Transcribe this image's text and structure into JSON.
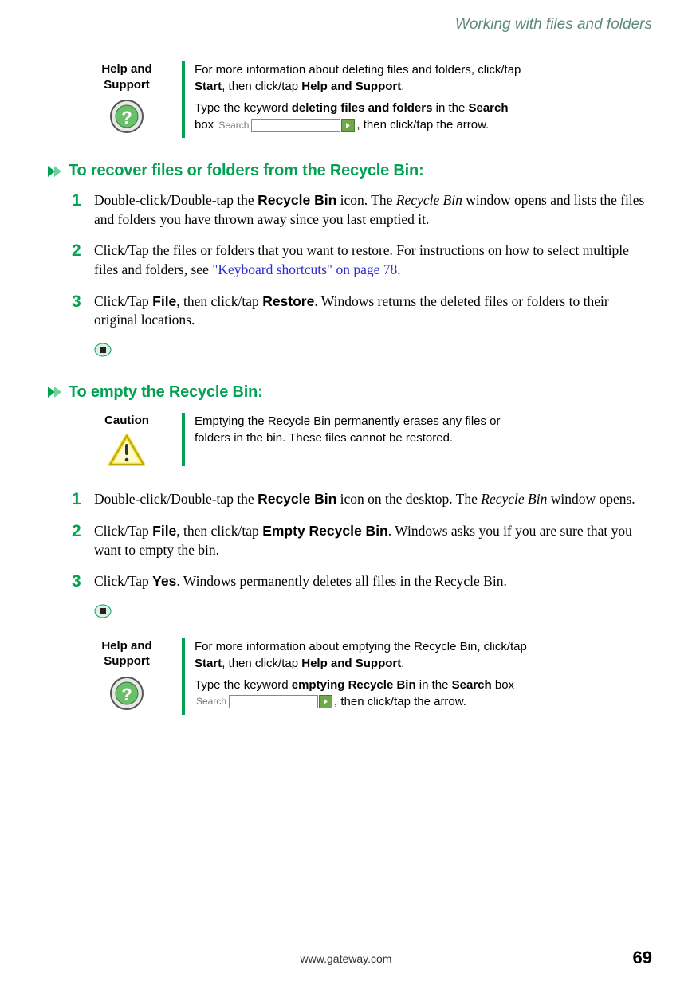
{
  "header": "Working with files and folders",
  "help1": {
    "label": "Help and Support",
    "p1_a": "For more information about deleting files and folders, click/tap ",
    "p1_b": "Start",
    "p1_c": ", then click/tap ",
    "p1_d": "Help and Support",
    "p1_e": ".",
    "p2_a": "Type the keyword ",
    "p2_b": "deleting files and folders",
    "p2_c": " in the ",
    "p2_d": "Search",
    "p2_e": " box ",
    "p2_f": ", then click/tap the arrow.",
    "search_label": "Search"
  },
  "section1": {
    "title": "To recover files or folders from the Recycle Bin:",
    "s1": {
      "n": "1",
      "a": "Double-click/Double-tap the ",
      "b": "Recycle Bin",
      "c": " icon. The ",
      "d": "Recycle Bin",
      "e": " window opens and lists the files and folders you have thrown away since you last emptied it."
    },
    "s2": {
      "n": "2",
      "a": "Click/Tap the files or folders that you want to restore. For instructions on how to select multiple files and folders, see ",
      "b": "\"Keyboard shortcuts\" on page 78",
      "c": "."
    },
    "s3": {
      "n": "3",
      "a": "Click/Tap ",
      "b": "File",
      "c": ", then click/tap ",
      "d": "Restore",
      "e": ". Windows returns the deleted files or folders to their original locations."
    }
  },
  "section2": {
    "title": "To empty the Recycle Bin:",
    "caution": {
      "label": "Caution",
      "text": "Emptying the Recycle Bin permanently erases any files or folders in the bin. These files cannot be restored."
    },
    "s1": {
      "n": "1",
      "a": "Double-click/Double-tap the ",
      "b": "Recycle Bin",
      "c": " icon on the desktop. The ",
      "d": "Recycle Bin",
      "e": " window opens."
    },
    "s2": {
      "n": "2",
      "a": "Click/Tap ",
      "b": "File",
      "c": ", then click/tap ",
      "d": "Empty Recycle Bin",
      "e": ". Windows asks you if you are sure that you want to empty the bin."
    },
    "s3": {
      "n": "3",
      "a": "Click/Tap ",
      "b": "Yes",
      "c": ". Windows permanently deletes all files in the Recycle Bin."
    }
  },
  "help2": {
    "label": "Help and Support",
    "p1_a": "For more information about emptying the Recycle Bin, click/tap ",
    "p1_b": "Start",
    "p1_c": ", then click/tap ",
    "p1_d": "Help and Support",
    "p1_e": ".",
    "p2_a": "Type the keyword ",
    "p2_b": "emptying Recycle Bin",
    "p2_c": " in the ",
    "p2_d": "Search",
    "p2_e": " box ",
    "p2_f": ", then click/tap the arrow.",
    "search_label": "Search"
  },
  "footer": {
    "url": "www.gateway.com",
    "page": "69"
  }
}
